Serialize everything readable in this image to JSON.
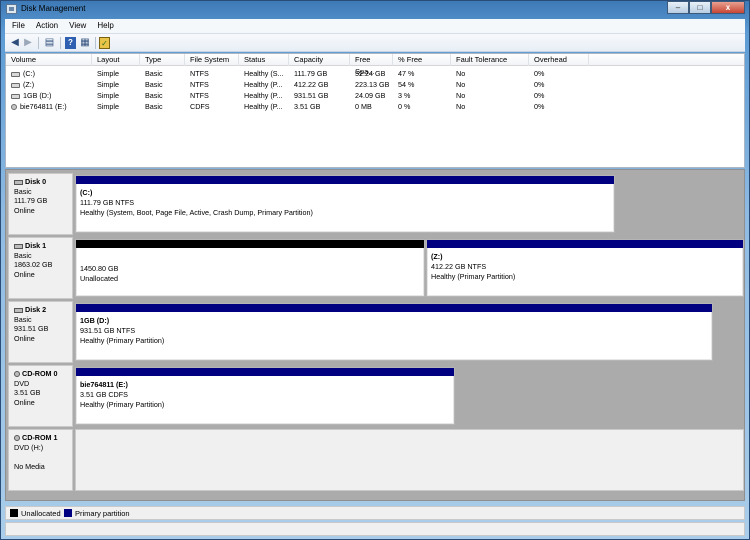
{
  "window": {
    "title": "Disk Management",
    "buttons": {
      "minimize": "–",
      "maximize": "□",
      "close": "x"
    }
  },
  "menu": [
    "File",
    "Action",
    "View",
    "Help"
  ],
  "toolbar": {
    "icons": [
      "back-arrow-icon",
      "forward-arrow-icon",
      "show-hide-console-tree-icon",
      "help-icon",
      "properties-icon",
      "disk-check-icon"
    ]
  },
  "volume_list": {
    "columns": [
      "Volume",
      "Layout",
      "Type",
      "File System",
      "Status",
      "Capacity",
      "Free Spa...",
      "% Free",
      "Fault Tolerance",
      "Overhead"
    ],
    "rows": [
      {
        "volume": "(C:)",
        "layout": "Simple",
        "type": "Basic",
        "fs": "NTFS",
        "status": "Healthy (S...",
        "capacity": "111.79 GB",
        "free": "52.24 GB",
        "pct": "47 %",
        "fault": "No",
        "overhead": "0%",
        "icon": "disk"
      },
      {
        "volume": "(Z:)",
        "layout": "Simple",
        "type": "Basic",
        "fs": "NTFS",
        "status": "Healthy (P...",
        "capacity": "412.22 GB",
        "free": "223.13 GB",
        "pct": "54 %",
        "fault": "No",
        "overhead": "0%",
        "icon": "disk"
      },
      {
        "volume": "1GB (D:)",
        "layout": "Simple",
        "type": "Basic",
        "fs": "NTFS",
        "status": "Healthy (P...",
        "capacity": "931.51 GB",
        "free": "24.09 GB",
        "pct": "3 %",
        "fault": "No",
        "overhead": "0%",
        "icon": "disk"
      },
      {
        "volume": "bie764811 (E:)",
        "layout": "Simple",
        "type": "Basic",
        "fs": "CDFS",
        "status": "Healthy (P...",
        "capacity": "3.51 GB",
        "free": "0 MB",
        "pct": "0 %",
        "fault": "No",
        "overhead": "0%",
        "icon": "cd"
      }
    ]
  },
  "disks": [
    {
      "name": "Disk 0",
      "type": "Basic",
      "size": "111.79 GB",
      "state": "Online",
      "partitions": [
        {
          "name": "(C:)",
          "size": "111.79 GB NTFS",
          "status": "Healthy (System, Boot, Page File, Active, Crash Dump, Primary Partition)",
          "kind": "primary"
        }
      ]
    },
    {
      "name": "Disk 1",
      "type": "Basic",
      "size": "1863.02 GB",
      "state": "Online",
      "partitions": [
        {
          "name": "",
          "size": "1450.80 GB",
          "status": "Unallocated",
          "kind": "unallocated"
        },
        {
          "name": "(Z:)",
          "size": "412.22 GB NTFS",
          "status": "Healthy (Primary Partition)",
          "kind": "primary"
        }
      ]
    },
    {
      "name": "Disk 2",
      "type": "Basic",
      "size": "931.51 GB",
      "state": "Online",
      "partitions": [
        {
          "name": "1GB  (D:)",
          "size": "931.51 GB NTFS",
          "status": "Healthy (Primary Partition)",
          "kind": "primary"
        }
      ]
    },
    {
      "name": "CD-ROM 0",
      "type": "DVD",
      "size": "3.51 GB",
      "state": "Online",
      "partitions": [
        {
          "name": "bie764811  (E:)",
          "size": "3.51 GB CDFS",
          "status": "Healthy (Primary Partition)",
          "kind": "primary"
        }
      ]
    },
    {
      "name": "CD-ROM 1",
      "type": "DVD (H:)",
      "size": "",
      "state": "No Media",
      "partitions": []
    }
  ],
  "legend": [
    {
      "label": "Unallocated",
      "color": "#000000"
    },
    {
      "label": "Primary partition",
      "color": "#000080"
    }
  ]
}
